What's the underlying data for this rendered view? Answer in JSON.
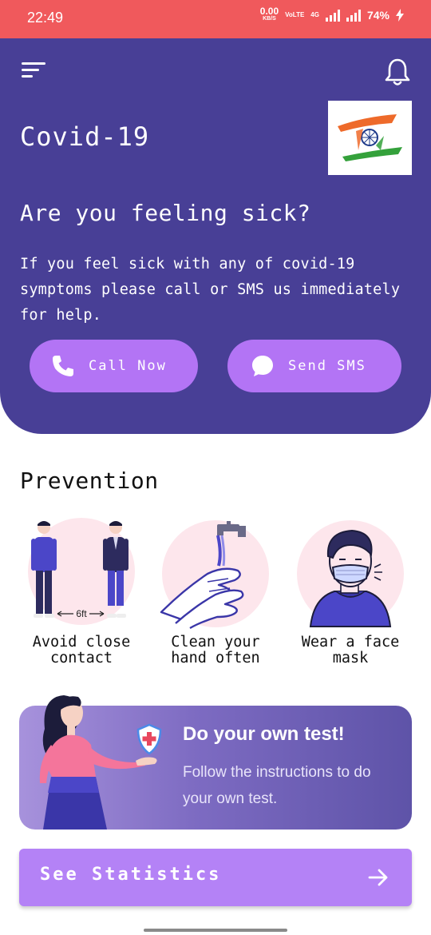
{
  "status_bar": {
    "time": "22:49",
    "net_speed": "0.00",
    "net_unit": "KB/S",
    "volte": "VoLTE",
    "network": "4G",
    "battery": "74%"
  },
  "header": {
    "app_title": "Covid-19",
    "heading": "Are you feeling sick?",
    "description": "If you feel sick with any of covid-19 symptoms please call or SMS us immediately for help.",
    "call_label": "Call Now",
    "sms_label": "Send SMS",
    "icons": {
      "menu": "menu-icon",
      "bell": "bell-icon",
      "call": "phone-icon",
      "sms": "chat-bubble-icon"
    }
  },
  "prevention": {
    "title": "Prevention",
    "distance_label": "6ft",
    "items": [
      {
        "label": "Avoid close contact"
      },
      {
        "label": "Clean your hand often"
      },
      {
        "label": "Wear a face mask"
      }
    ]
  },
  "test_card": {
    "heading": "Do your own test!",
    "description": "Follow the instructions to do your own test."
  },
  "stats_button": {
    "label": "See Statistics",
    "icon": "arrow-right-icon"
  },
  "colors": {
    "status_bar": "#f0595c",
    "header_bg": "#483f96",
    "accent": "#b374f5",
    "illus_circle": "#fde6ec"
  }
}
